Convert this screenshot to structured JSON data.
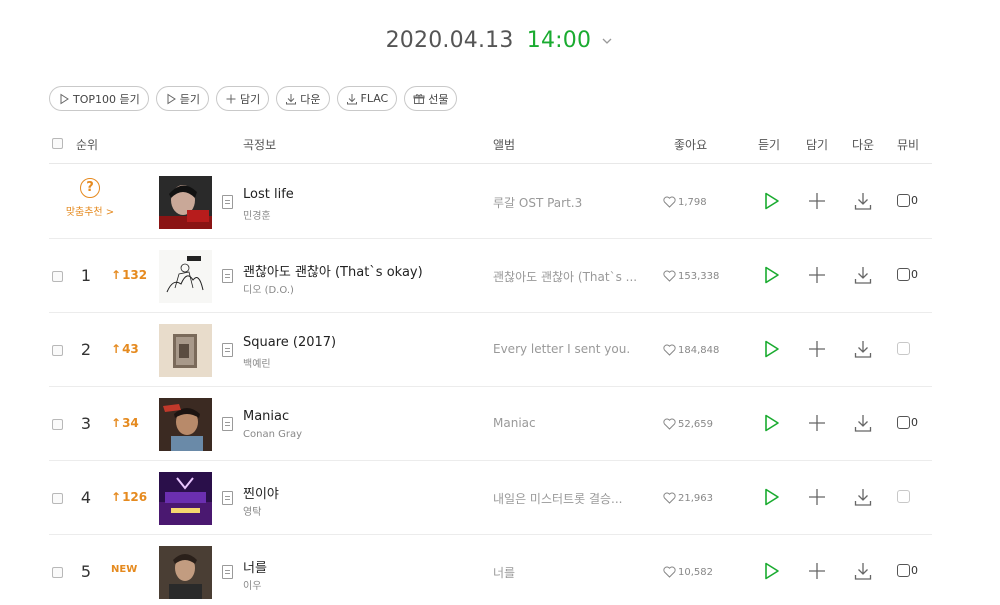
{
  "chart_time": {
    "date": "2020.04.13",
    "time": "14:00",
    "accent": "#1aab30"
  },
  "toolbar": [
    {
      "icon": "play-outline-icon",
      "label": "TOP100 듣기"
    },
    {
      "icon": "play-outline-icon",
      "label": "듣기"
    },
    {
      "icon": "plus-icon",
      "label": "담기"
    },
    {
      "icon": "download-icon",
      "label": "다운"
    },
    {
      "icon": "download-icon",
      "label": "FLAC"
    },
    {
      "icon": "gift-icon",
      "label": "선물"
    }
  ],
  "columns": {
    "rank": "순위",
    "song_info": "곡정보",
    "album": "앨범",
    "likes": "좋아요",
    "listen": "듣기",
    "add": "담기",
    "download": "다운",
    "mv": "뮤비"
  },
  "recommended": {
    "badge": "?",
    "label": "맞춤추천 >",
    "title": "Lost life",
    "artist": "민경훈",
    "album": "루갈 OST Part.3",
    "likes": "1,798",
    "mv_count": "0",
    "mv_available": true
  },
  "rows": [
    {
      "rank": "1",
      "delta": "132",
      "title": "괜찮아도 괜찮아 (That`s okay)",
      "artist": "디오 (D.O.)",
      "album": "괜찮아도 괜찮아 (That`s ...",
      "likes": "153,338",
      "mv_count": "0",
      "mv_available": true
    },
    {
      "rank": "2",
      "delta": "43",
      "title": "Square (2017)",
      "artist": "백예린",
      "album": "Every letter I sent you.",
      "likes": "184,848",
      "mv_count": "",
      "mv_available": false
    },
    {
      "rank": "3",
      "delta": "34",
      "title": "Maniac",
      "artist": "Conan Gray",
      "album": "Maniac",
      "likes": "52,659",
      "mv_count": "0",
      "mv_available": true
    },
    {
      "rank": "4",
      "delta": "126",
      "title": "찐이야",
      "artist": "영탁",
      "album": "내일은 미스터트롯 결승...",
      "likes": "21,963",
      "mv_count": "",
      "mv_available": false
    },
    {
      "rank": "5",
      "delta": "NEW",
      "title": "너를",
      "artist": "이우",
      "album": "너를",
      "likes": "10,582",
      "mv_count": "0",
      "mv_available": true
    }
  ],
  "colors": {
    "accent_green": "#1aab30",
    "rise_orange": "#e58a1f"
  }
}
